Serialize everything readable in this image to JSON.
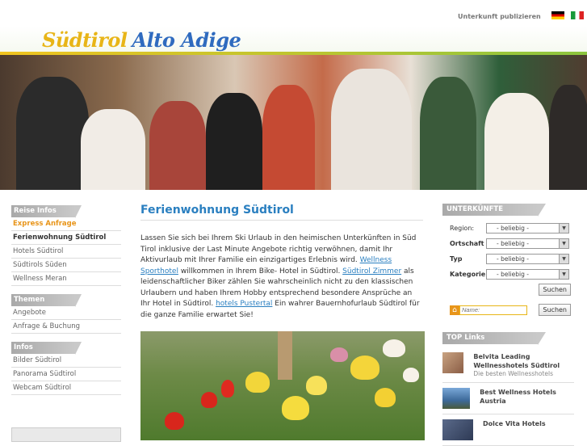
{
  "header": {
    "publish_link": "Unterkunft publizieren",
    "flags": [
      "flag-germany-icon",
      "flag-italy-icon"
    ]
  },
  "banner": {
    "title_part1": "Südtirol",
    "title_part2": "Alto Adige"
  },
  "sidebar": {
    "sections": [
      {
        "title": "Reise Infos",
        "items": [
          "Express Anfrage",
          "Ferienwohnung Südtirol",
          "Hotels Südtirol",
          "Südtirols Süden",
          "Wellness Meran"
        ]
      },
      {
        "title": "Themen",
        "items": [
          "Angebote",
          "Anfrage & Buchung"
        ]
      },
      {
        "title": "Infos",
        "items": [
          "Bilder Südtirol",
          "Panorama Südtirol",
          "Webcam Südtirol"
        ]
      }
    ]
  },
  "main": {
    "heading": "Ferienwohnung Südtirol",
    "p1": "Lassen Sie sich bei Ihrem Ski Urlaub in den heimischen Unterkünften in Süd Tirol inklusive der Last Minute Angebote richtig verwöhnen, damit Ihr Aktivurlaub mit Ihrer Familie ein einzigartiges Erlebnis wird. ",
    "link1": "Wellness Sporthotel",
    "p2": " willkommen in Ihrem Bike- Hotel in Südtirol. ",
    "link2": "Südtirol Zimmer",
    "p3": " als leidenschaftlicher Biker zählen Sie wahrscheinlich nicht zu den klassischen Urlaubern und haben Ihrem Hobby entsprechend besondere Ansprüche an Ihr Hotel in Südtirol. ",
    "link3": "hotels Pustertal",
    "p4": " Ein wahrer Bauernhofurlaub Südtirol für die ganze Familie erwartet Sie!"
  },
  "search": {
    "title": "UNTERKÜNFTE",
    "fields": [
      {
        "label": "Region:",
        "value": "- beliebig -"
      },
      {
        "label": "Ortschaft",
        "value": "- beliebig -"
      },
      {
        "label": "Typ",
        "value": "- beliebig -"
      },
      {
        "label": "Kategorie",
        "value": "- beliebig -"
      }
    ],
    "search_button": "Suchen",
    "name_placeholder": "Name:",
    "name_button": "Suchen"
  },
  "toplinks": {
    "title": "TOP Links",
    "items": [
      {
        "title": "Belvita Leading Wellnesshotels Südtirol",
        "subtitle": "Die besten Wellnesshotels"
      },
      {
        "title": "Best Wellness Hotels Austria",
        "subtitle": ""
      },
      {
        "title": "Dolce Vita Hotels",
        "subtitle": ""
      }
    ]
  }
}
